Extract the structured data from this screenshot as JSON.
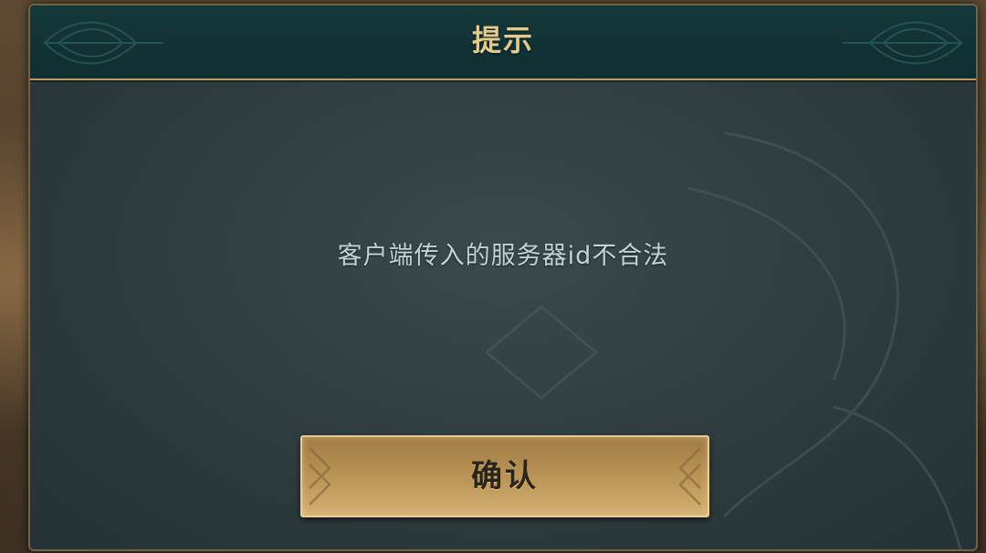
{
  "dialog": {
    "title": "提示",
    "message": "客户端传入的服务器id不合法",
    "confirm_label": "确认"
  },
  "colors": {
    "title_gold": "#e2c98e",
    "header_teal": "#14383a",
    "panel_slate": "#2e3c3f",
    "button_gold": "#d4b071",
    "message_text": "#c5d2d3"
  },
  "icons": {
    "header_left": "leaf-ornament-icon",
    "header_right": "leaf-ornament-icon",
    "button_left": "chevron-ornament-icon",
    "button_right": "chevron-ornament-icon"
  }
}
